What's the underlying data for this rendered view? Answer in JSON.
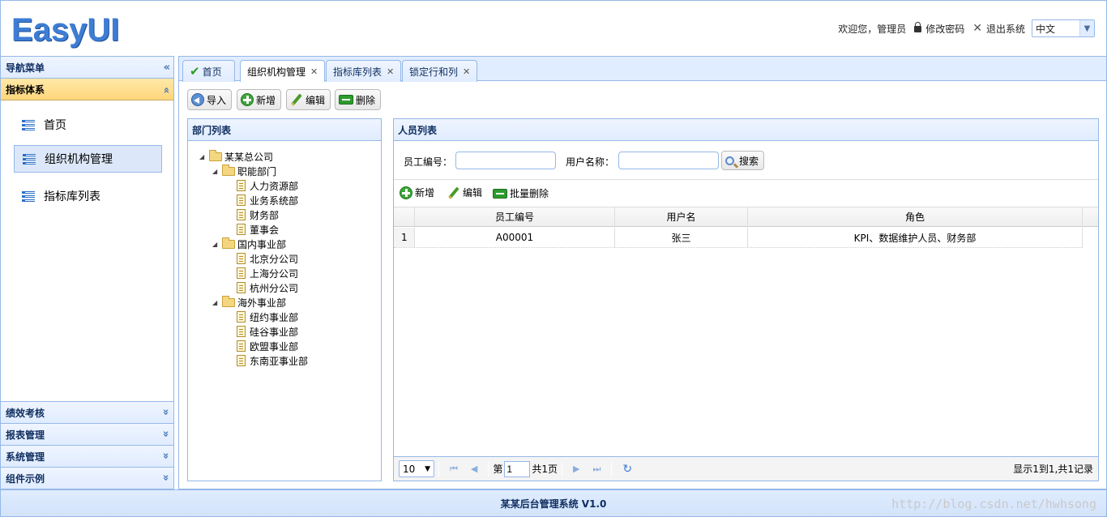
{
  "header": {
    "logo": "EasyUI",
    "welcome": "欢迎您，管理员",
    "change_password": "修改密码",
    "logout": "退出系统",
    "language": "中文"
  },
  "west": {
    "nav_title": "导航菜单",
    "active_group": "指标体系",
    "items": [
      {
        "label": "首页"
      },
      {
        "label": "组织机构管理"
      },
      {
        "label": "指标库列表"
      }
    ],
    "collapsed_groups": [
      {
        "label": "绩效考核"
      },
      {
        "label": "报表管理"
      },
      {
        "label": "系统管理"
      },
      {
        "label": "组件示例"
      }
    ]
  },
  "tabs": [
    {
      "label": "首页"
    },
    {
      "label": "组织机构管理"
    },
    {
      "label": "指标库列表"
    },
    {
      "label": "锁定行和列"
    }
  ],
  "toolbar": {
    "import": "导入",
    "add": "新增",
    "edit": "编辑",
    "delete": "删除"
  },
  "dept_panel": {
    "title": "部门列表",
    "tree": [
      {
        "label": "某某总公司"
      },
      {
        "label": "职能部门"
      },
      {
        "label": "人力资源部"
      },
      {
        "label": "业务系统部"
      },
      {
        "label": "财务部"
      },
      {
        "label": "董事会"
      },
      {
        "label": "国内事业部"
      },
      {
        "label": "北京分公司"
      },
      {
        "label": "上海分公司"
      },
      {
        "label": "杭州分公司"
      },
      {
        "label": "海外事业部"
      },
      {
        "label": "纽约事业部"
      },
      {
        "label": "硅谷事业部"
      },
      {
        "label": "欧盟事业部"
      },
      {
        "label": "东南亚事业部"
      }
    ]
  },
  "person_panel": {
    "title": "人员列表",
    "emp_no_label": "员工编号：",
    "user_name_label": "用户名称：",
    "emp_no_value": "",
    "user_name_value": "",
    "search": "搜索",
    "tb_add": "新增",
    "tb_edit": "编辑",
    "tb_batch_delete": "批量删除",
    "columns": [
      "员工编号",
      "用户名",
      "角色"
    ],
    "rows": [
      {
        "num": "1",
        "emp_no": "A00001",
        "user": "张三",
        "role": "KPI、数据维护人员、财务部"
      }
    ],
    "pager": {
      "page_size": "10",
      "page_prefix": "第",
      "page": "1",
      "total_pages": "共1页",
      "info": "显示1到1,共1记录"
    }
  },
  "footer": {
    "text": "某某后台管理系统 V1.0",
    "watermark": "http://blog.csdn.net/hwhsong"
  }
}
